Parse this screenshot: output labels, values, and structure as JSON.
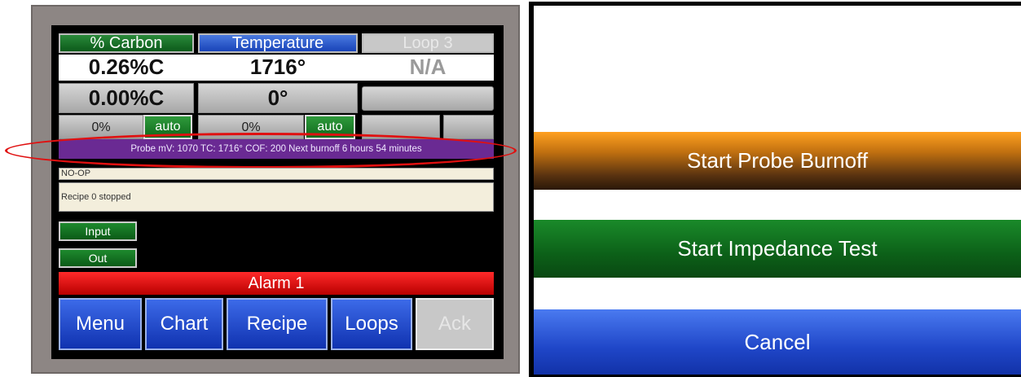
{
  "left_screen": {
    "tabs": {
      "carbon": "% Carbon",
      "temperature": "Temperature",
      "loop": "Loop 3"
    },
    "process_values": {
      "carbon": "0.26%C",
      "temperature": "1716°",
      "loop": "N/A"
    },
    "setpoints": {
      "carbon": "0.00%C",
      "temperature": "0°"
    },
    "outputs": {
      "carbon_percent": "0%",
      "carbon_mode": "auto",
      "temperature_percent": "0%",
      "temperature_mode": "auto"
    },
    "probe_status": "Probe mV: 1070 TC: 1716° COF: 200 Next burnoff 6 hours 54 minutes",
    "status_lines": [
      "NO-OP",
      "Recipe 0 stopped"
    ],
    "io_buttons": {
      "input": "Input",
      "out": "Out"
    },
    "alarm": "Alarm 1",
    "nav": {
      "menu": "Menu",
      "chart": "Chart",
      "recipe": "Recipe",
      "loops": "Loops",
      "ack": "Ack"
    }
  },
  "right_screen": {
    "start_burnoff": "Start Probe Burnoff",
    "start_impedance": "Start Impedance Test",
    "cancel": "Cancel"
  },
  "colors": {
    "carbon_tab": "#1a7a2a",
    "temperature_tab": "#2a5ad0",
    "probe_bar": "#6a2a93",
    "alarm": "#e01010",
    "nav_button": "#2448c8",
    "highlight": "#e01010"
  }
}
